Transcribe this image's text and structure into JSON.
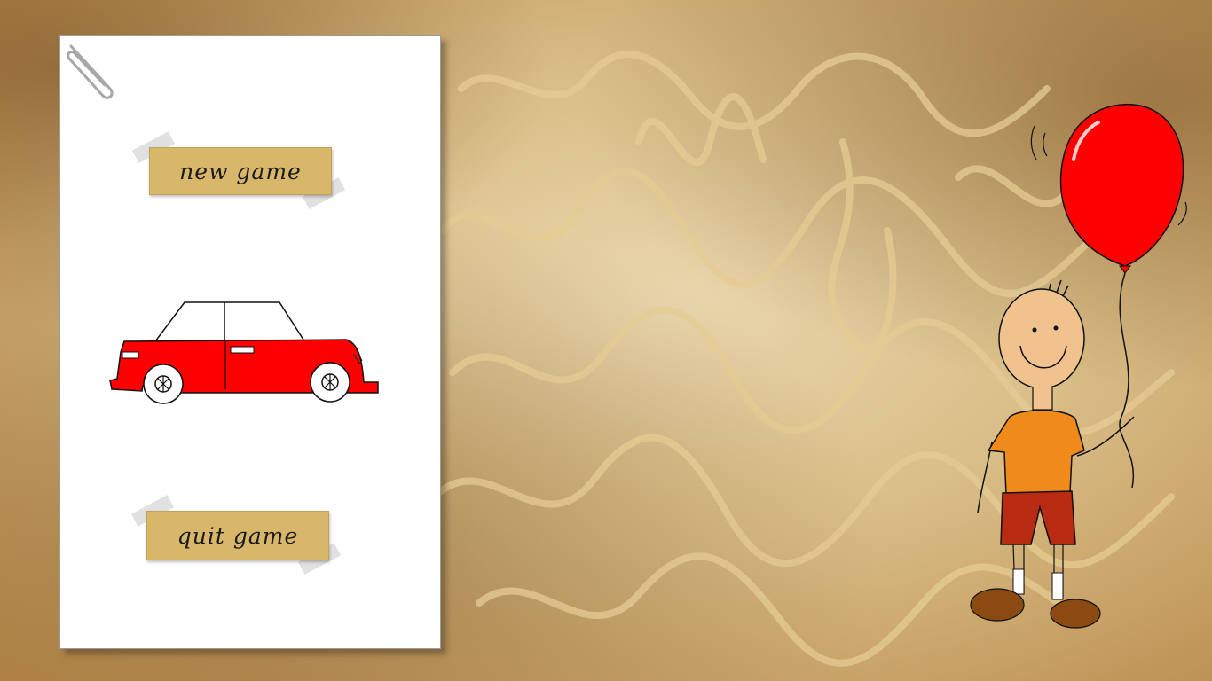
{
  "menu": {
    "new_game_label": "new game",
    "quit_game_label": "quit game"
  },
  "colors": {
    "tape": "#d9b76a",
    "car_body": "#ff0000",
    "balloon": "#ff0000",
    "shirt": "#f08a1a",
    "shorts": "#b82a12",
    "paper": "#ffffff"
  },
  "icons": [
    "paperclip-icon",
    "car-illustration",
    "boy-with-balloon-illustration"
  ]
}
